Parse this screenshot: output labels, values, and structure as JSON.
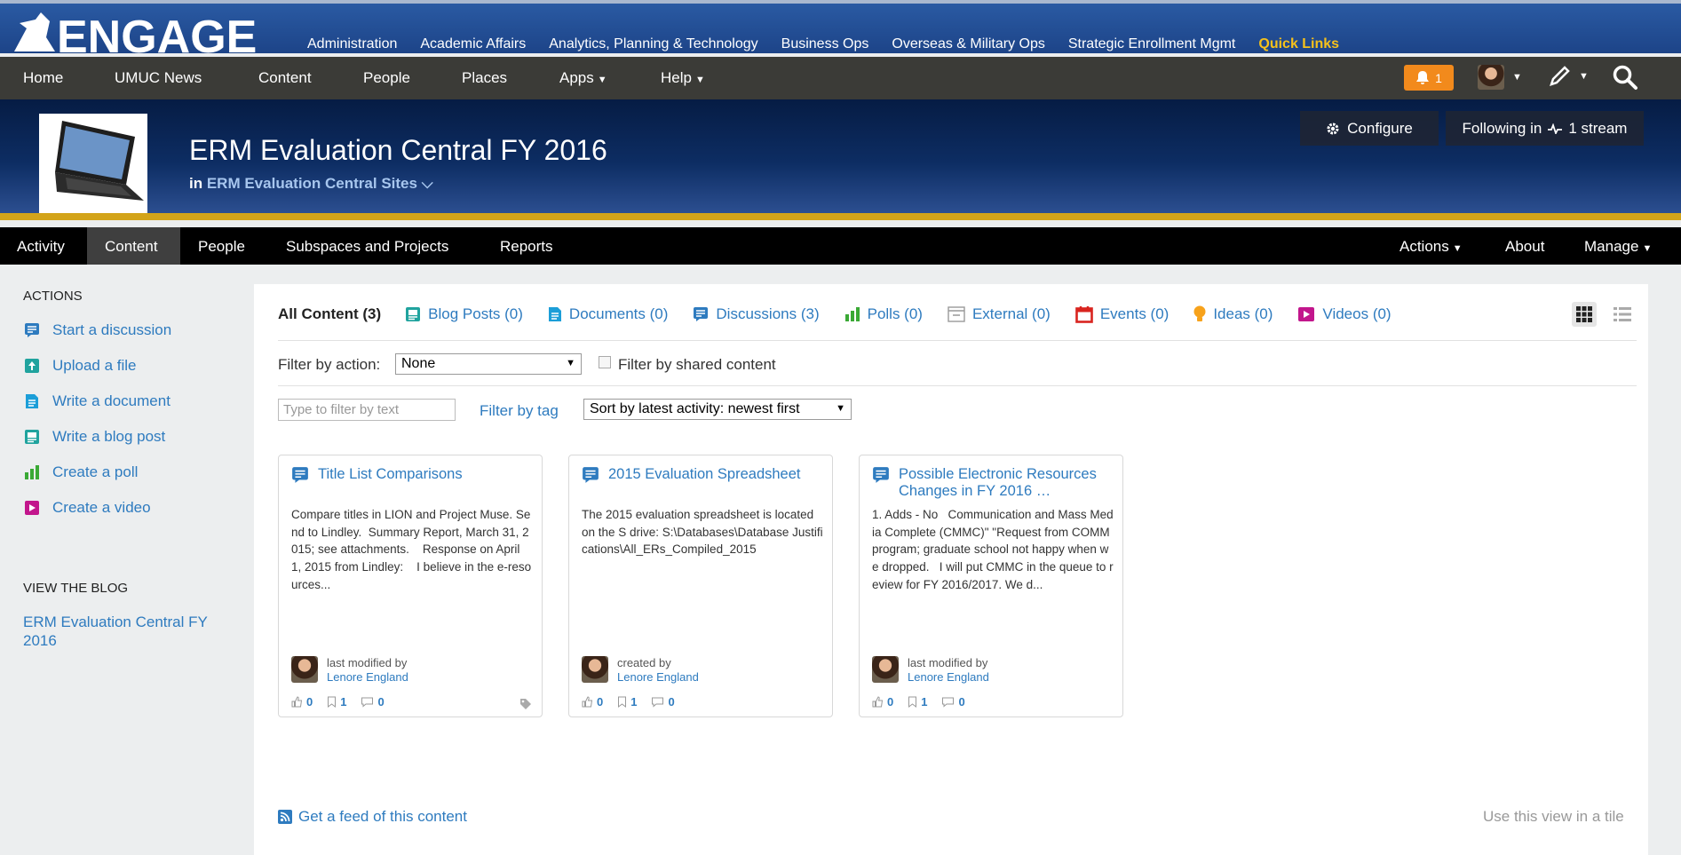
{
  "brand": {
    "name": "ENGAGE"
  },
  "site_links": [
    {
      "label": "Administration"
    },
    {
      "label": "Academic Affairs"
    },
    {
      "label": "Analytics, Planning & Technology"
    },
    {
      "label": "Business Ops"
    },
    {
      "label": "Overseas & Military Ops"
    },
    {
      "label": "Strategic Enrollment Mgmt"
    },
    {
      "label": "Quick Links"
    }
  ],
  "main_nav": {
    "home": "Home",
    "news": "UMUC News",
    "content": "Content",
    "people": "People",
    "places": "Places",
    "apps": "Apps",
    "help": "Help"
  },
  "notifications": {
    "count": "1"
  },
  "place": {
    "title": "ERM Evaluation Central FY 2016",
    "in_prefix": "in",
    "parent": "ERM Evaluation Central Sites",
    "configure": "Configure",
    "following_prefix": "Following in",
    "following_suffix": "1 stream"
  },
  "place_nav": {
    "activity": "Activity",
    "content": "Content",
    "people": "People",
    "subspaces": "Subspaces and Projects",
    "reports": "Reports",
    "actions": "Actions",
    "about": "About",
    "manage": "Manage"
  },
  "sidebar": {
    "actions_heading": "ACTIONS",
    "actions": [
      {
        "label": "Start a discussion"
      },
      {
        "label": "Upload a file"
      },
      {
        "label": "Write a document"
      },
      {
        "label": "Write a blog post"
      },
      {
        "label": "Create a poll"
      },
      {
        "label": "Create a video"
      }
    ],
    "blog_heading": "VIEW THE BLOG",
    "blog_link": "ERM Evaluation Central FY 2016"
  },
  "content_tabs": [
    {
      "label": "All Content (3)"
    },
    {
      "label": "Blog Posts (0)"
    },
    {
      "label": "Documents (0)"
    },
    {
      "label": "Discussions (3)"
    },
    {
      "label": "Polls (0)"
    },
    {
      "label": "External (0)"
    },
    {
      "label": "Events (0)"
    },
    {
      "label": "Ideas (0)"
    },
    {
      "label": "Videos (0)"
    }
  ],
  "filters": {
    "action_label": "Filter by action:",
    "action_value": "None",
    "shared_label": "Filter by shared content",
    "text_placeholder": "Type to filter by text",
    "tag_label": "Filter by tag",
    "sort_value": "Sort by latest activity: newest first"
  },
  "cards": [
    {
      "title": "Title List Comparisons",
      "body": "Compare titles in LION and Project Muse. Send to Lindley.  Summary Report, March 31, 2015; see attachments.    Response on April 1, 2015 from Lindley:    I believe in the e-resources...",
      "meta": "last modified by",
      "author": "Lenore England",
      "likes": "0",
      "bookmarks": "1",
      "comments": "0"
    },
    {
      "title": "2015 Evaluation Spreadsheet",
      "body": "The 2015 evaluation spreadsheet is located on the S drive: S:\\Databases\\Database Justifications\\All_ERs_Compiled_2015",
      "meta": "created by",
      "author": "Lenore England",
      "likes": "0",
      "bookmarks": "1",
      "comments": "0"
    },
    {
      "title": "Possible Electronic Resources Changes in FY 2016 …",
      "body": "1. Adds - No   Communication and Mass Media Complete (CMMC)\" \"Request from COMM program; graduate school not happy when we dropped.   I will put CMMC in the queue to review for FY 2016/2017. We d...",
      "meta": "last modified by",
      "author": "Lenore England",
      "likes": "0",
      "bookmarks": "1",
      "comments": "0"
    }
  ],
  "footer": {
    "feed": "Get a feed of this content",
    "tile": "Use this view in a tile"
  },
  "colors": {
    "link": "#2e7bbf",
    "quick_links": "#f6c11b",
    "notification": "#f28a1c",
    "gold_rule": "#d3a41a"
  }
}
